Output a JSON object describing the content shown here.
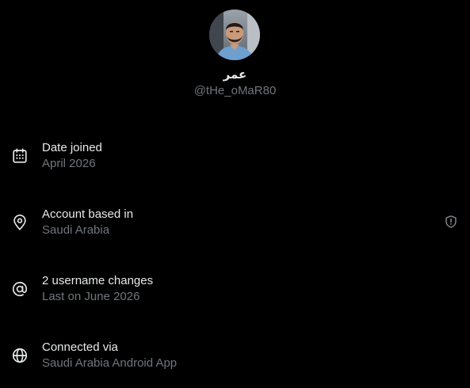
{
  "profile": {
    "display_name": "عمر",
    "handle": "@tHe_oMaR80"
  },
  "details": [
    {
      "icon": "calendar-icon",
      "title": "Date joined",
      "value": "April 2026"
    },
    {
      "icon": "location-pin-icon",
      "title": "Account based in",
      "value": "Saudi Arabia",
      "trailing_icon": "shield-alert-icon"
    },
    {
      "icon": "at-sign-icon",
      "title": "2 username changes",
      "value": "Last on June 2026"
    },
    {
      "icon": "globe-icon",
      "title": "Connected via",
      "value": "Saudi Arabia Android App"
    }
  ],
  "colors": {
    "background": "#000000",
    "primary_text": "#e7e9ea",
    "secondary_text": "#71767b"
  }
}
